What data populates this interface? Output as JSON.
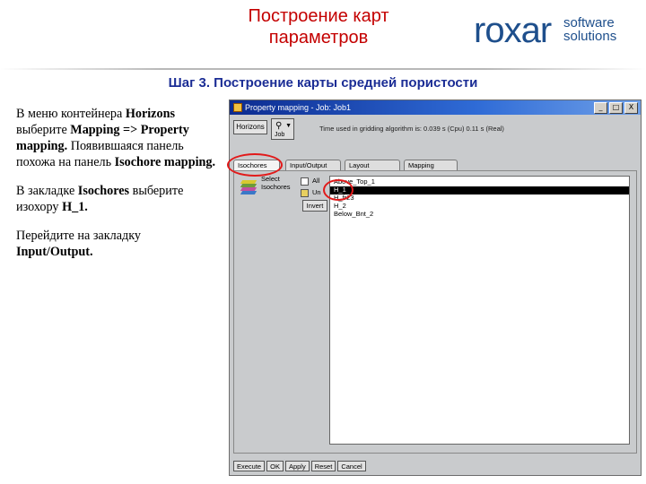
{
  "header": {
    "title_line1": "Построение карт",
    "title_line2": "параметров",
    "subtitle": "Шаг 3. Построение карты средней пористости"
  },
  "logo": {
    "word": "roxar",
    "line1": "software",
    "line2": "solutions",
    "color": "#1e4f8c"
  },
  "body_text": {
    "p1_a": "В меню контейнера ",
    "p1_b": "Horizons",
    "p1_c": " выберите ",
    "p1_d": "Mapping => Property mapping.",
    "p1_e": " Появившаяся панель похожа на панель ",
    "p1_f": "Isochore mapping.",
    "p2_a": "В закладке ",
    "p2_b": "Isochores",
    "p2_c": " выберите изохору ",
    "p2_d": "H_1.",
    "p3_a": "Перейдите на закладку ",
    "p3_b": "Input/Output."
  },
  "window": {
    "title": "Property mapping - Job: Job1",
    "buttons": [
      "_",
      "□",
      "X"
    ],
    "horizons_button": "Horizons",
    "job_label": "Job",
    "time_text": "Time used in gridding algorithm is: 0.039 s (Cpu)  0.11 s (Real)",
    "tabs": [
      "Isochores",
      "Input/Output",
      "Layout",
      "Mapping"
    ],
    "active_tab": "Isochores",
    "select_label_1": "Select",
    "select_label_2": "Isochores",
    "checkbox_all": "All",
    "checkbox_un": "Un",
    "invert_button": "Invert",
    "list_items": [
      "Above_Top_1",
      "H_1",
      "H_fr23",
      "H_2",
      "Below_Bnt_2"
    ],
    "selected_item": "H_1",
    "bottom_buttons": [
      "Execute",
      "OK",
      "Apply",
      "Reset",
      "Cancel"
    ],
    "highlight_color": "#e21a1a"
  }
}
